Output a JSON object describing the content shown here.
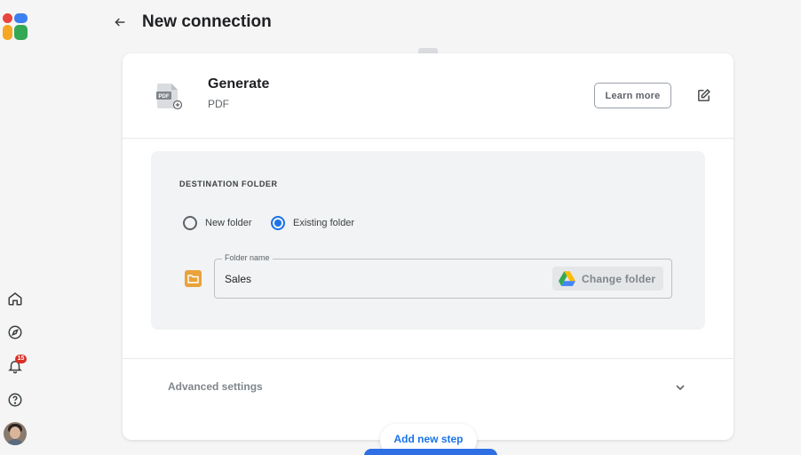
{
  "header": {
    "title": "New connection"
  },
  "step": {
    "title": "Generate",
    "subtitle": "PDF",
    "icon_text": "PDF",
    "learn_more_label": "Learn more"
  },
  "destination": {
    "section_label": "DESTINATION FOLDER",
    "options": [
      {
        "label": "New folder",
        "checked": false
      },
      {
        "label": "Existing folder",
        "checked": true
      }
    ],
    "field_label": "Folder name",
    "field_value": "Sales",
    "change_folder_label": "Change folder"
  },
  "advanced": {
    "label": "Advanced settings"
  },
  "add_step_label": "Add new step",
  "notifications": {
    "count": "15"
  },
  "colors": {
    "accent": "#1a73e8",
    "folder": "#e8a33a",
    "badge": "#d93025"
  }
}
